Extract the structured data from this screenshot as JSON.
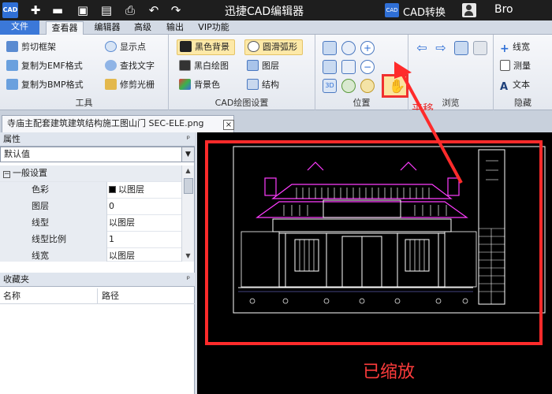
{
  "titlebar": {
    "logo": "CAD",
    "app_title": "迅捷CAD编辑器",
    "cad_icon": "CAD",
    "cad_convert": "CAD转换",
    "user": "Bro",
    "quick_access_icons": [
      "new-file-icon",
      "open-folder-icon",
      "save-icon",
      "save-as-icon",
      "print-icon",
      "undo-icon",
      "redo-icon"
    ]
  },
  "ribbon_tabs": {
    "file": "文件",
    "viewer": "查看器",
    "editor": "编辑器",
    "advanced": "高级",
    "output": "输出",
    "vip": "VIP功能"
  },
  "ribbon": {
    "tools": {
      "label": "工具",
      "crop_frame": "剪切框架",
      "copy_emf": "复制为EMF格式",
      "copy_bmp": "复制为BMP格式",
      "show_points": "显示点",
      "find_text": "查找文字",
      "trim_raster": "修剪光栅"
    },
    "cad_settings": {
      "label": "CAD绘图设置",
      "black_bg": "黑色背景",
      "bw_draw": "黑白绘图",
      "bg_color": "背景色",
      "smooth_arc": "圆滑弧形",
      "layers": "图层",
      "structure": "结构"
    },
    "position": {
      "label": "位置",
      "pan_label": "平移"
    },
    "browse": {
      "label": "浏览"
    },
    "hidden": {
      "label": "隐藏",
      "linewidth": "线宽",
      "measure": "测量",
      "text": "文本"
    }
  },
  "document": {
    "tab_title": "寺庙主配套建筑建筑结构施工图山门 SEC-ELE.png",
    "close": "×"
  },
  "properties": {
    "header": "属性",
    "pin": "ᵖ",
    "combo_value": "默认值",
    "category": "一般设置",
    "category_toggle": "−",
    "rows": [
      {
        "name": "色彩",
        "value": "以图层"
      },
      {
        "name": "图层",
        "value": "0"
      },
      {
        "name": "线型",
        "value": "以图层"
      },
      {
        "name": "线型比例",
        "value": "1"
      },
      {
        "name": "线宽",
        "value": "以图层"
      }
    ]
  },
  "favorites": {
    "header": "收藏夹",
    "pin": "ᵖ",
    "col_name": "名称",
    "col_path": "路径"
  },
  "canvas": {
    "zoom_label": "已缩放"
  },
  "colors": {
    "titlebar": "#1e1e1e",
    "file_tab": "#3b78d8",
    "highlight": "#fde9a8",
    "annotation_red": "#ff2b2b",
    "cad_magenta": "#ff3cff",
    "cad_white": "#ffffff"
  }
}
